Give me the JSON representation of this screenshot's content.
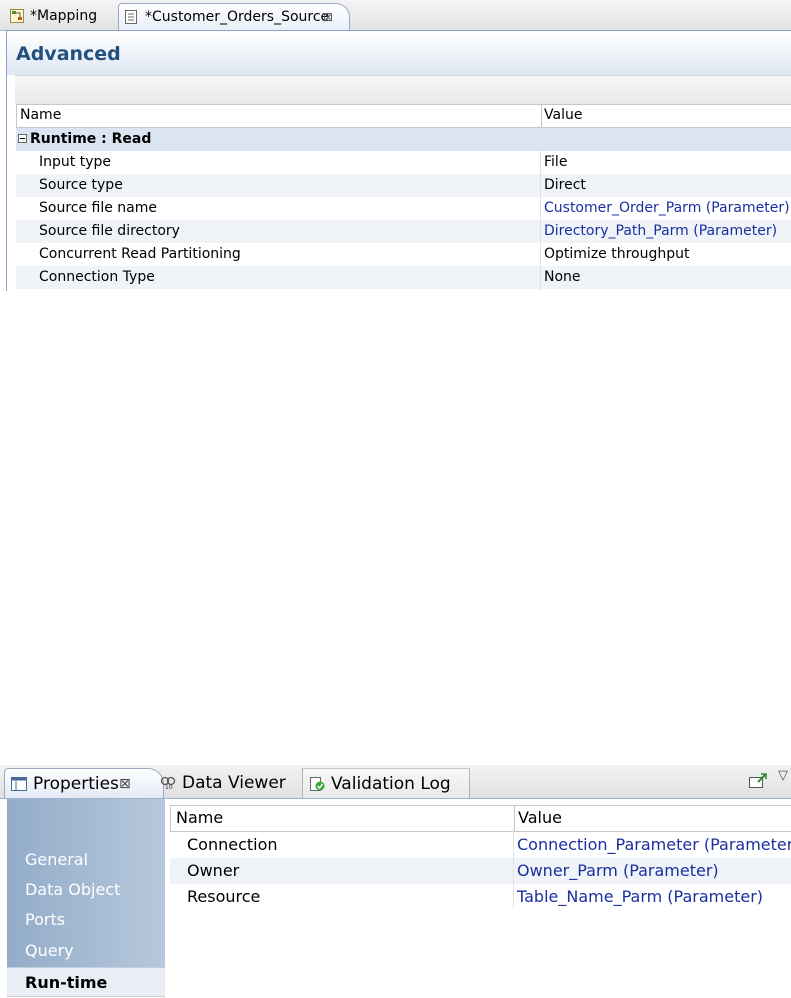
{
  "editor": {
    "tabs": [
      {
        "label": "*Mapping",
        "icon": "mapping-icon"
      },
      {
        "label": "*Customer_Orders_Source",
        "icon": "data-object-icon",
        "close": "⊠"
      }
    ],
    "section_title": "Advanced",
    "columns": [
      "Name",
      "Value"
    ],
    "group": {
      "label": "Runtime : Read",
      "expanded": true
    },
    "rows": [
      {
        "name": "Input type",
        "value": "File",
        "is_parameter": false
      },
      {
        "name": "Source type",
        "value": "Direct",
        "is_parameter": false
      },
      {
        "name": "Source file name",
        "value": "Customer_Order_Parm (Parameter)",
        "is_parameter": true
      },
      {
        "name": "Source file directory",
        "value": "Directory_Path_Parm (Parameter)",
        "is_parameter": true
      },
      {
        "name": "Concurrent Read Partitioning",
        "value": "Optimize throughput",
        "is_parameter": false
      },
      {
        "name": "Connection Type",
        "value": "None",
        "is_parameter": false
      }
    ]
  },
  "properties_view": {
    "tabs": [
      {
        "label": "Properties",
        "icon": "properties-icon",
        "close": "⊠",
        "active": true
      },
      {
        "label": "Data Viewer",
        "icon": "data-viewer-icon"
      },
      {
        "label": "Validation Log",
        "icon": "validation-log-icon"
      }
    ],
    "toolbar_icons": [
      "pin-icon",
      "view-menu-icon"
    ],
    "sidebar": [
      {
        "label": "General",
        "active": false
      },
      {
        "label": "Data Object",
        "active": false
      },
      {
        "label": "Ports",
        "active": false
      },
      {
        "label": "Query",
        "active": false
      },
      {
        "label": "Run-time",
        "active": true
      }
    ],
    "columns": [
      "Name",
      "Value"
    ],
    "rows": [
      {
        "name": "Connection",
        "value": "Connection_Parameter (Parameter)",
        "is_parameter": true
      },
      {
        "name": "Owner",
        "value": "Owner_Parm (Parameter)",
        "is_parameter": true
      },
      {
        "name": "Resource",
        "value": "Table_Name_Parm (Parameter)",
        "is_parameter": true
      }
    ]
  },
  "colors": {
    "section_title": "#22507f",
    "parameter_link": "#1a2fa0",
    "sidebar_bg": "#92acc9",
    "group_row_bg": "#dbe5f1"
  }
}
